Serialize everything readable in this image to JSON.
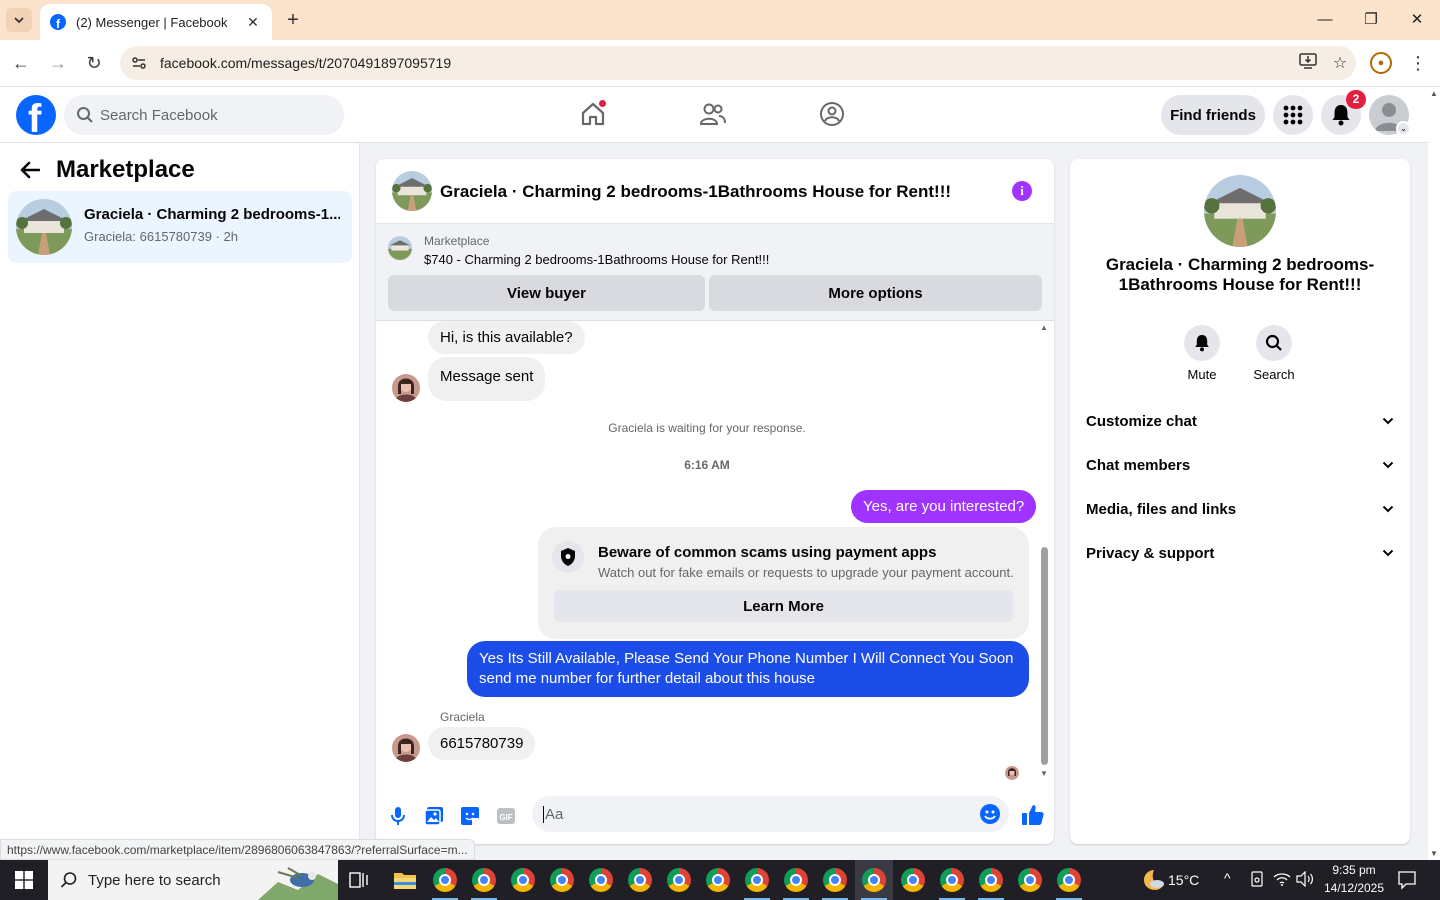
{
  "browser": {
    "tab_title": "(2) Messenger | Facebook",
    "url": "facebook.com/messages/t/2070491897095719",
    "status_url": "https://www.facebook.com/marketplace/item/2896806063847863/?referralSurface=m..."
  },
  "fb_header": {
    "search_placeholder": "Search Facebook",
    "find_friends_label": "Find friends",
    "notification_count": "2"
  },
  "sidebar": {
    "title": "Marketplace",
    "conversation": {
      "name": "Graciela · Charming 2 bedrooms-1...",
      "preview": "Graciela: 6615780739 · 2h"
    }
  },
  "chat": {
    "title": "Graciela · Charming 2 bedrooms-1Bathrooms House for Rent!!!",
    "listing": {
      "label": "Marketplace",
      "title": "$740 - Charming 2 bedrooms-1Bathrooms House for Rent!!!",
      "view_buyer": "View buyer",
      "more_options": "More options"
    },
    "messages": {
      "m1": "Hi, is this available?",
      "m2": "Message sent",
      "waiting_note": "Graciela is waiting for your response.",
      "timestamp": "6:16 AM",
      "m3": "Yes, are you interested?",
      "m4": "Yes Its Still Available, Please Send Your Phone Number I Will Connect You Soon send me number for further detail about this house",
      "sender_name": "Graciela",
      "m5": "6615780739"
    },
    "scam_card": {
      "title": "Beware of common scams using payment apps",
      "text": "Watch out for fake emails or requests to upgrade your payment account.",
      "button": "Learn More"
    },
    "composer_placeholder": "Aa"
  },
  "info_panel": {
    "title": "Graciela · Charming 2 bedrooms-1Bathrooms House for Rent!!!",
    "mute_label": "Mute",
    "search_label": "Search",
    "rows": [
      "Customize chat",
      "Chat members",
      "Media, files and links",
      "Privacy & support"
    ]
  },
  "taskbar": {
    "search_placeholder": "Type here to search",
    "weather": "15°C",
    "time": "9:35 pm",
    "date": "14/12/2025"
  },
  "colors": {
    "fb_blue": "#0866ff",
    "bubble_purple": "#a033ff",
    "bubble_blue": "#1d4de8",
    "selected_conv": "#ebf5ff"
  }
}
